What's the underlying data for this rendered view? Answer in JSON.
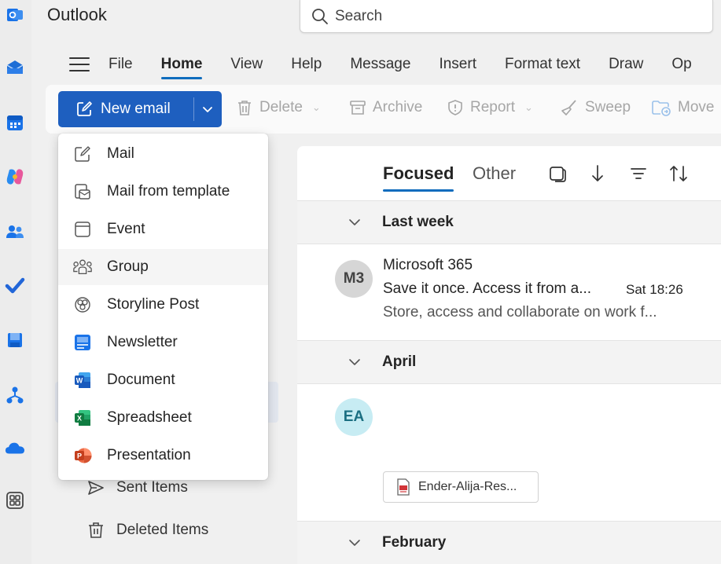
{
  "app": {
    "title": "Outlook"
  },
  "search": {
    "placeholder": "Search"
  },
  "ribbon": {
    "tabs": [
      {
        "label": "File"
      },
      {
        "label": "Home",
        "active": true
      },
      {
        "label": "View"
      },
      {
        "label": "Help"
      },
      {
        "label": "Message"
      },
      {
        "label": "Insert"
      },
      {
        "label": "Format text"
      },
      {
        "label": "Draw"
      },
      {
        "label": "Op"
      }
    ]
  },
  "toolbar": {
    "new_email_label": "New email",
    "delete_label": "Delete",
    "archive_label": "Archive",
    "report_label": "Report",
    "sweep_label": "Sweep",
    "move_label": "Move"
  },
  "new_menu": {
    "items": [
      {
        "label": "Mail",
        "icon": "compose-icon"
      },
      {
        "label": "Mail from template",
        "icon": "template-icon"
      },
      {
        "label": "Event",
        "icon": "calendar-event-icon"
      },
      {
        "label": "Group",
        "icon": "group-icon",
        "hovered": true
      },
      {
        "label": "Storyline Post",
        "icon": "storyline-icon"
      },
      {
        "label": "Newsletter",
        "icon": "newsletter-icon"
      },
      {
        "label": "Document",
        "icon": "word-icon"
      },
      {
        "label": "Spreadsheet",
        "icon": "excel-icon"
      },
      {
        "label": "Presentation",
        "icon": "powerpoint-icon"
      }
    ]
  },
  "folders": {
    "sent_label": "Sent Items",
    "deleted_label": "Deleted Items"
  },
  "message_list": {
    "tabs": {
      "focused": "Focused",
      "other": "Other"
    },
    "groups": [
      {
        "label": "Last week"
      },
      {
        "label": "April"
      },
      {
        "label": "February"
      }
    ],
    "messages": [
      {
        "initials": "M3",
        "sender": "Microsoft 365",
        "subject": "Save it once. Access it from a...",
        "time": "Sat 18:26",
        "preview": "Store, access and collaborate on work f...",
        "avatar_color": "#d6d6d6"
      },
      {
        "initials": "EA",
        "attachment": "Ender-Alija-Res...",
        "avatar_color": "#c7ecf3"
      }
    ]
  },
  "colors": {
    "accent": "#0f6cbd",
    "new_email_bg": "#1e5fbf"
  }
}
